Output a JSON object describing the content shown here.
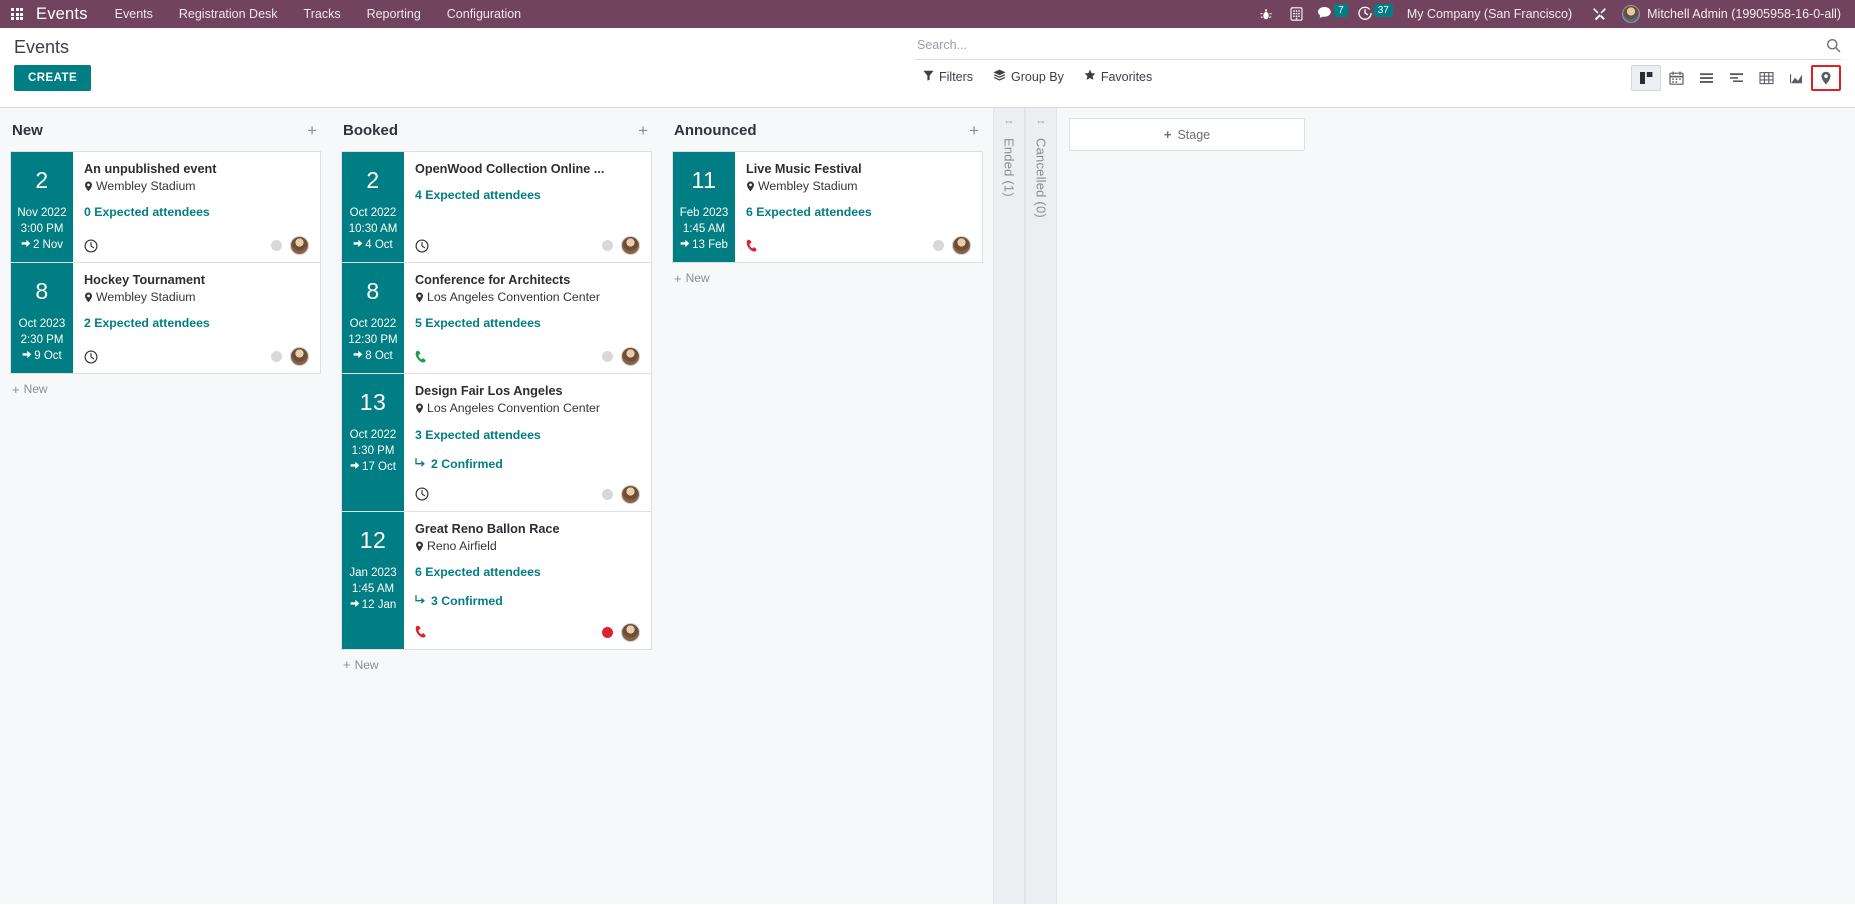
{
  "navbar": {
    "apps_icon": "apps-grid-icon",
    "brand": "Events",
    "menu": [
      "Events",
      "Registration Desk",
      "Tracks",
      "Reporting",
      "Configuration"
    ],
    "sys_icons": [
      "bug-icon",
      "phone-keypad-icon"
    ],
    "messages_badge": "7",
    "activities_badge": "37",
    "company": "My Company (San Francisco)",
    "tools_icon": "tools-icon",
    "user": "Mitchell Admin (19905958-16-0-all)"
  },
  "control_panel": {
    "title": "Events",
    "create_label": "CREATE",
    "search_placeholder": "Search...",
    "filters": [
      {
        "label": "Filters",
        "icon": "filter-icon"
      },
      {
        "label": "Group By",
        "icon": "layers-icon"
      },
      {
        "label": "Favorites",
        "icon": "star-icon"
      }
    ],
    "views": [
      {
        "name": "kanban",
        "icon": "kanban-icon",
        "active": true,
        "highlighted": false
      },
      {
        "name": "calendar",
        "icon": "calendar-icon",
        "active": false,
        "highlighted": false
      },
      {
        "name": "list",
        "icon": "list-icon",
        "active": false,
        "highlighted": false
      },
      {
        "name": "gantt",
        "icon": "gantt-icon",
        "active": false,
        "highlighted": false
      },
      {
        "name": "pivot",
        "icon": "pivot-table-icon",
        "active": false,
        "highlighted": false
      },
      {
        "name": "graph",
        "icon": "graph-icon",
        "active": false,
        "highlighted": false
      },
      {
        "name": "map",
        "icon": "map-pin-icon",
        "active": false,
        "highlighted": true
      }
    ]
  },
  "kanban": {
    "new_record_label": "New",
    "add_stage_label": "Stage",
    "columns": [
      {
        "title": "New",
        "cards": [
          {
            "day": "2",
            "month": "Nov 2022",
            "time": "3:00 PM",
            "end": "2 Nov",
            "title": "An unpublished event",
            "location": "Wembley Stadium",
            "attendees": "0 Expected attendees",
            "confirmed": null,
            "activity_icon": "clock-icon",
            "activity_color": "dark",
            "status_color": "grey"
          },
          {
            "day": "8",
            "month": "Oct 2023",
            "time": "2:30 PM",
            "end": "9 Oct",
            "title": "Hockey Tournament",
            "location": "Wembley Stadium",
            "attendees": "2 Expected attendees",
            "confirmed": null,
            "activity_icon": "clock-icon",
            "activity_color": "dark",
            "status_color": "grey"
          }
        ]
      },
      {
        "title": "Booked",
        "cards": [
          {
            "day": "2",
            "month": "Oct 2022",
            "time": "10:30 AM",
            "end": "4 Oct",
            "title": "OpenWood Collection Online ...",
            "location": null,
            "attendees": "4 Expected attendees",
            "confirmed": null,
            "activity_icon": "clock-icon",
            "activity_color": "dark",
            "status_color": "grey"
          },
          {
            "day": "8",
            "month": "Oct 2022",
            "time": "12:30 PM",
            "end": "8 Oct",
            "title": "Conference for Architects",
            "location": "Los Angeles Convention Center",
            "attendees": "5 Expected attendees",
            "confirmed": null,
            "activity_icon": "phone-icon",
            "activity_color": "green",
            "status_color": "grey"
          },
          {
            "day": "13",
            "month": "Oct 2022",
            "time": "1:30 PM",
            "end": "17 Oct",
            "title": "Design Fair Los Angeles",
            "location": "Los Angeles Convention Center",
            "attendees": "3 Expected attendees",
            "confirmed": "2 Confirmed",
            "activity_icon": "clock-icon",
            "activity_color": "dark",
            "status_color": "grey"
          },
          {
            "day": "12",
            "month": "Jan 2023",
            "time": "1:45 AM",
            "end": "12 Jan",
            "title": "Great Reno Ballon Race",
            "location": "Reno Airfield",
            "attendees": "6 Expected attendees",
            "confirmed": "3 Confirmed",
            "activity_icon": "phone-icon",
            "activity_color": "red",
            "status_color": "red"
          }
        ]
      },
      {
        "title": "Announced",
        "cards": [
          {
            "day": "11",
            "month": "Feb 2023",
            "time": "1:45 AM",
            "end": "13 Feb",
            "title": "Live Music Festival",
            "location": "Wembley Stadium",
            "attendees": "6 Expected attendees",
            "confirmed": null,
            "activity_icon": "phone-icon",
            "activity_color": "red",
            "status_color": "grey"
          }
        ]
      }
    ],
    "folded_columns": [
      {
        "label": "Ended (1)"
      },
      {
        "label": "Cancelled (0)"
      }
    ]
  },
  "colors": {
    "brand_purple": "#71435f",
    "accent_teal": "#017e84",
    "highlight_red": "#e02020",
    "status_red": "#d9232d",
    "phone_green": "#1e9e4a"
  }
}
